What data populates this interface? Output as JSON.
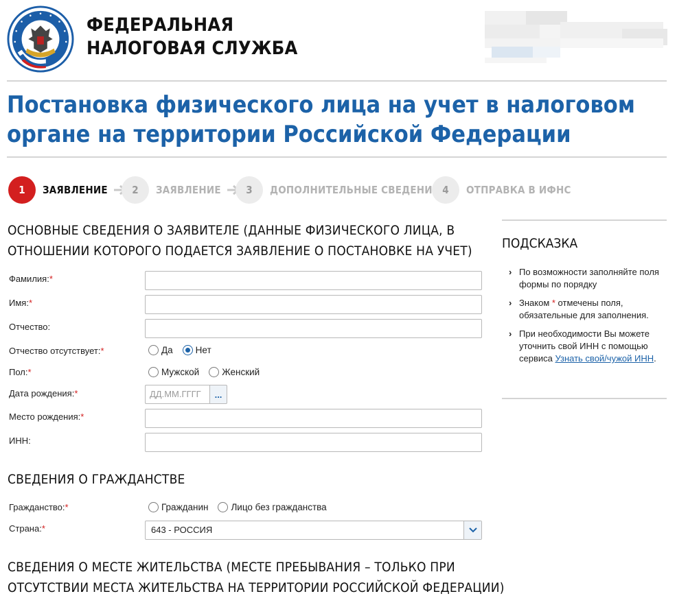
{
  "header": {
    "brand_line1": "ФЕДЕРАЛЬНАЯ",
    "brand_line2": "НАЛОГОВАЯ СЛУЖБА"
  },
  "page_title": "Постановка физического лица на учет в налоговом органе на территории Российской Федерации",
  "steps": [
    {
      "number": "1",
      "label": "ЗАЯВЛЕНИЕ",
      "active": true
    },
    {
      "number": "2",
      "label": "ЗАЯВЛЕНИЕ",
      "active": false
    },
    {
      "number": "3",
      "label": "ДОПОЛНИТЕЛЬНЫЕ СВЕДЕНИЯ",
      "active": false
    },
    {
      "number": "4",
      "label": "ОТПРАВКА В ИФНС",
      "active": false
    }
  ],
  "section_basic": {
    "title_line1": "ОСНОВНЫЕ СВЕДЕНИЯ О ЗАЯВИТЕЛЕ (ДАННЫЕ ФИЗИЧЕСКОГО ЛИЦА, В",
    "title_line2": "ОТНОШЕНИИ КОТОРОГО ПОДАЕТСЯ ЗАЯВЛЕНИЕ О ПОСТАНОВКЕ НА УЧЕТ)",
    "surname_label": "Фамилия:",
    "name_label": "Имя:",
    "patronymic_label": "Отчество:",
    "no_patronymic_label": "Отчество отсутствует:",
    "no_patronymic_yes": "Да",
    "no_patronymic_no": "Нет",
    "gender_label": "Пол:",
    "gender_male": "Мужской",
    "gender_female": "Женский",
    "birth_date_label": "Дата рождения:",
    "birth_date_placeholder": "ДД.ММ.ГГГГ",
    "birth_date_button": "...",
    "birth_place_label": "Место рождения:",
    "inn_label": "ИНН:"
  },
  "section_citizenship": {
    "title": "СВЕДЕНИЯ О ГРАЖДАНСТВЕ",
    "citizenship_label": "Гражданство:",
    "option_citizen": "Гражданин",
    "option_stateless": "Лицо без гражданства",
    "country_label": "Страна:",
    "country_value": "643 - РОССИЯ"
  },
  "section_residence": {
    "title_line1": "СВЕДЕНИЯ О МЕСТЕ ЖИТЕЛЬСТВА (МЕСТЕ ПРЕБЫВАНИЯ – ТОЛЬКО ПРИ",
    "title_line2": "ОТСУТСТВИИ МЕСТА ЖИТЕЛЬСТВА НА ТЕРРИТОРИИ РОССИЙСКОЙ ФЕДЕРАЦИИ)"
  },
  "required_mark": "*",
  "hint": {
    "title": "ПОДСКАЗКА",
    "item1": "По возможности заполняйте поля формы по порядку",
    "item2_before": "Знаком ",
    "item2_star": "*",
    "item2_after": " отмечены поля, обязательные для заполнения.",
    "item3_before": "При необходимости Вы можете уточнить свой ИНН с помощью сервиса ",
    "item3_link": "Узнать свой/чужой ИНН",
    "item3_after": "."
  },
  "colors": {
    "brand_blue": "#1c62a8",
    "active_red": "#d31f1f",
    "inactive_grey": "#b3b3b3"
  }
}
